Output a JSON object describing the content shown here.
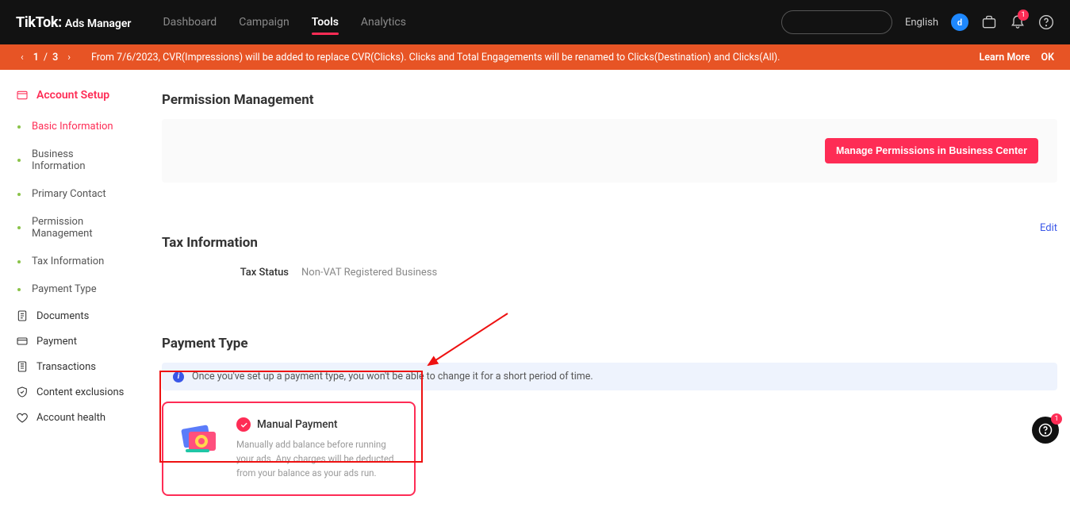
{
  "header": {
    "brand_main": "TikTok:",
    "brand_sub": "Ads Manager",
    "nav": [
      {
        "label": "Dashboard",
        "active": false
      },
      {
        "label": "Campaign",
        "active": false
      },
      {
        "label": "Tools",
        "active": true
      },
      {
        "label": "Analytics",
        "active": false
      }
    ],
    "language": "English",
    "avatar_letter": "d",
    "bell_badge": "1"
  },
  "announcement": {
    "current": "1",
    "sep": "/",
    "total": "3",
    "message": "From 7/6/2023, CVR(Impressions) will be added to replace CVR(Clicks). Clicks and Total Engagements will be renamed to Clicks(Destination) and Clicks(All).",
    "learn_more": "Learn More",
    "ok": "OK"
  },
  "sidebar": {
    "account_setup": "Account Setup",
    "sub_items": [
      "Basic Information",
      "Business Information",
      "Primary Contact",
      "Permission Management",
      "Tax Information",
      "Payment Type"
    ],
    "items": {
      "documents": "Documents",
      "payment": "Payment",
      "transactions": "Transactions",
      "content_exclusions": "Content exclusions",
      "account_health": "Account health"
    }
  },
  "permission": {
    "title": "Permission Management",
    "button": "Manage Permissions in Business Center"
  },
  "tax": {
    "title": "Tax Information",
    "edit": "Edit",
    "status_label": "Tax Status",
    "status_value": "Non-VAT Registered Business"
  },
  "payment": {
    "title": "Payment Type",
    "banner": "Once you've set up a payment type, you won't be able to change it for a short period of time.",
    "option_title": "Manual Payment",
    "option_desc": "Manually add balance before running your ads. Any charges will be deducted from your balance as your ads run."
  },
  "fab_badge": "1"
}
